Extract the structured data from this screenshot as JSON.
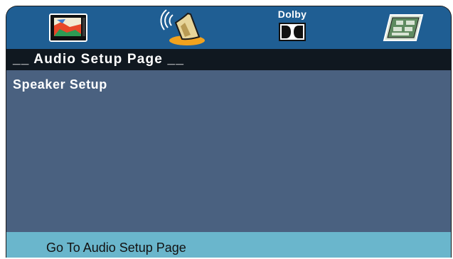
{
  "menu": {
    "icons": [
      {
        "name": "general-setup-icon"
      },
      {
        "name": "audio-setup-icon",
        "selected": true
      },
      {
        "name": "dolby-digital-setup-icon",
        "label": "Dolby"
      },
      {
        "name": "preference-page-icon"
      }
    ]
  },
  "title": "__ Audio Setup Page __",
  "items": [
    {
      "label": "Speaker Setup"
    }
  ],
  "status": "Go To Audio Setup Page",
  "colors": {
    "menu_bar": "#1f5e93",
    "title_bar": "#101820",
    "content": "#4a6180",
    "status_bar": "#6ab6cc",
    "selected_highlight": "#f1a21e"
  }
}
